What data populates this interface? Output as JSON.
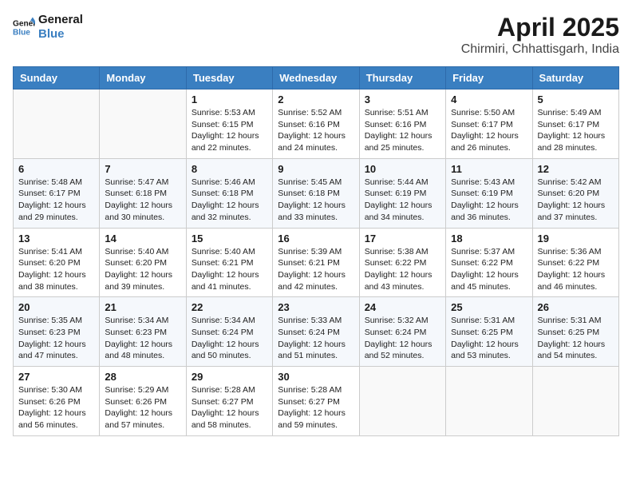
{
  "logo": {
    "line1": "General",
    "line2": "Blue"
  },
  "title": "April 2025",
  "subtitle": "Chirmiri, Chhattisgarh, India",
  "weekdays": [
    "Sunday",
    "Monday",
    "Tuesday",
    "Wednesday",
    "Thursday",
    "Friday",
    "Saturday"
  ],
  "weeks": [
    [
      {
        "day": "",
        "info": ""
      },
      {
        "day": "",
        "info": ""
      },
      {
        "day": "1",
        "info": "Sunrise: 5:53 AM\nSunset: 6:15 PM\nDaylight: 12 hours and 22 minutes."
      },
      {
        "day": "2",
        "info": "Sunrise: 5:52 AM\nSunset: 6:16 PM\nDaylight: 12 hours and 24 minutes."
      },
      {
        "day": "3",
        "info": "Sunrise: 5:51 AM\nSunset: 6:16 PM\nDaylight: 12 hours and 25 minutes."
      },
      {
        "day": "4",
        "info": "Sunrise: 5:50 AM\nSunset: 6:17 PM\nDaylight: 12 hours and 26 minutes."
      },
      {
        "day": "5",
        "info": "Sunrise: 5:49 AM\nSunset: 6:17 PM\nDaylight: 12 hours and 28 minutes."
      }
    ],
    [
      {
        "day": "6",
        "info": "Sunrise: 5:48 AM\nSunset: 6:17 PM\nDaylight: 12 hours and 29 minutes."
      },
      {
        "day": "7",
        "info": "Sunrise: 5:47 AM\nSunset: 6:18 PM\nDaylight: 12 hours and 30 minutes."
      },
      {
        "day": "8",
        "info": "Sunrise: 5:46 AM\nSunset: 6:18 PM\nDaylight: 12 hours and 32 minutes."
      },
      {
        "day": "9",
        "info": "Sunrise: 5:45 AM\nSunset: 6:18 PM\nDaylight: 12 hours and 33 minutes."
      },
      {
        "day": "10",
        "info": "Sunrise: 5:44 AM\nSunset: 6:19 PM\nDaylight: 12 hours and 34 minutes."
      },
      {
        "day": "11",
        "info": "Sunrise: 5:43 AM\nSunset: 6:19 PM\nDaylight: 12 hours and 36 minutes."
      },
      {
        "day": "12",
        "info": "Sunrise: 5:42 AM\nSunset: 6:20 PM\nDaylight: 12 hours and 37 minutes."
      }
    ],
    [
      {
        "day": "13",
        "info": "Sunrise: 5:41 AM\nSunset: 6:20 PM\nDaylight: 12 hours and 38 minutes."
      },
      {
        "day": "14",
        "info": "Sunrise: 5:40 AM\nSunset: 6:20 PM\nDaylight: 12 hours and 39 minutes."
      },
      {
        "day": "15",
        "info": "Sunrise: 5:40 AM\nSunset: 6:21 PM\nDaylight: 12 hours and 41 minutes."
      },
      {
        "day": "16",
        "info": "Sunrise: 5:39 AM\nSunset: 6:21 PM\nDaylight: 12 hours and 42 minutes."
      },
      {
        "day": "17",
        "info": "Sunrise: 5:38 AM\nSunset: 6:22 PM\nDaylight: 12 hours and 43 minutes."
      },
      {
        "day": "18",
        "info": "Sunrise: 5:37 AM\nSunset: 6:22 PM\nDaylight: 12 hours and 45 minutes."
      },
      {
        "day": "19",
        "info": "Sunrise: 5:36 AM\nSunset: 6:22 PM\nDaylight: 12 hours and 46 minutes."
      }
    ],
    [
      {
        "day": "20",
        "info": "Sunrise: 5:35 AM\nSunset: 6:23 PM\nDaylight: 12 hours and 47 minutes."
      },
      {
        "day": "21",
        "info": "Sunrise: 5:34 AM\nSunset: 6:23 PM\nDaylight: 12 hours and 48 minutes."
      },
      {
        "day": "22",
        "info": "Sunrise: 5:34 AM\nSunset: 6:24 PM\nDaylight: 12 hours and 50 minutes."
      },
      {
        "day": "23",
        "info": "Sunrise: 5:33 AM\nSunset: 6:24 PM\nDaylight: 12 hours and 51 minutes."
      },
      {
        "day": "24",
        "info": "Sunrise: 5:32 AM\nSunset: 6:24 PM\nDaylight: 12 hours and 52 minutes."
      },
      {
        "day": "25",
        "info": "Sunrise: 5:31 AM\nSunset: 6:25 PM\nDaylight: 12 hours and 53 minutes."
      },
      {
        "day": "26",
        "info": "Sunrise: 5:31 AM\nSunset: 6:25 PM\nDaylight: 12 hours and 54 minutes."
      }
    ],
    [
      {
        "day": "27",
        "info": "Sunrise: 5:30 AM\nSunset: 6:26 PM\nDaylight: 12 hours and 56 minutes."
      },
      {
        "day": "28",
        "info": "Sunrise: 5:29 AM\nSunset: 6:26 PM\nDaylight: 12 hours and 57 minutes."
      },
      {
        "day": "29",
        "info": "Sunrise: 5:28 AM\nSunset: 6:27 PM\nDaylight: 12 hours and 58 minutes."
      },
      {
        "day": "30",
        "info": "Sunrise: 5:28 AM\nSunset: 6:27 PM\nDaylight: 12 hours and 59 minutes."
      },
      {
        "day": "",
        "info": ""
      },
      {
        "day": "",
        "info": ""
      },
      {
        "day": "",
        "info": ""
      }
    ]
  ]
}
